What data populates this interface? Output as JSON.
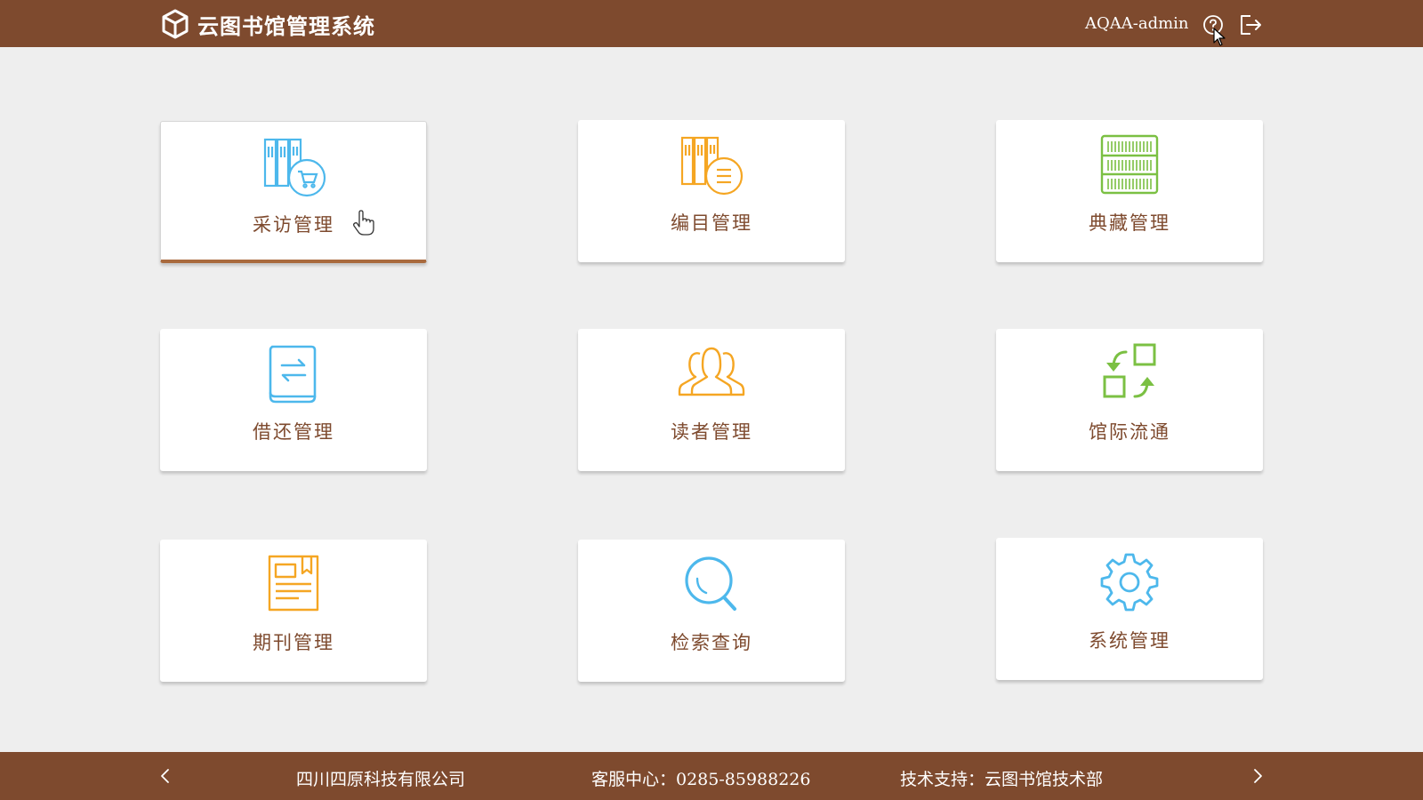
{
  "header": {
    "app_title": "云图书馆管理系统",
    "username": "AQAA-admin",
    "icons": {
      "logo": "box-logo-icon",
      "help": "help-circle-icon",
      "logout": "logout-icon"
    }
  },
  "colors": {
    "header_bg": "#7e4a2e",
    "page_bg": "#eeeeee",
    "label_text": "#7e4a2e",
    "active_underline": "#a96a3d",
    "icon_blue": "#4db8ec",
    "icon_orange": "#f5a623",
    "icon_green": "#7bc043"
  },
  "modules": [
    {
      "label": "采访管理",
      "icon": "bookshelf-cart-icon",
      "active": true
    },
    {
      "label": "编目管理",
      "icon": "bookshelf-list-icon",
      "active": false
    },
    {
      "label": "典藏管理",
      "icon": "barcode-shelf-icon",
      "active": false
    },
    {
      "label": "借还管理",
      "icon": "book-exchange-icon",
      "active": false
    },
    {
      "label": "读者管理",
      "icon": "readers-group-icon",
      "active": false
    },
    {
      "label": "馆际流通",
      "icon": "circulation-arrows-icon",
      "active": false
    },
    {
      "label": "期刊管理",
      "icon": "periodical-icon",
      "active": false
    },
    {
      "label": "检索查询",
      "icon": "search-icon",
      "active": false
    },
    {
      "label": "系统管理",
      "icon": "gear-icon",
      "active": false
    }
  ],
  "footer": {
    "company": "四川四原科技有限公司",
    "service": "客服中心：0285-85988226",
    "support": "技术支持：云图书馆技术部",
    "icons": {
      "prev": "chevron-left-icon",
      "next": "chevron-right-icon"
    }
  }
}
